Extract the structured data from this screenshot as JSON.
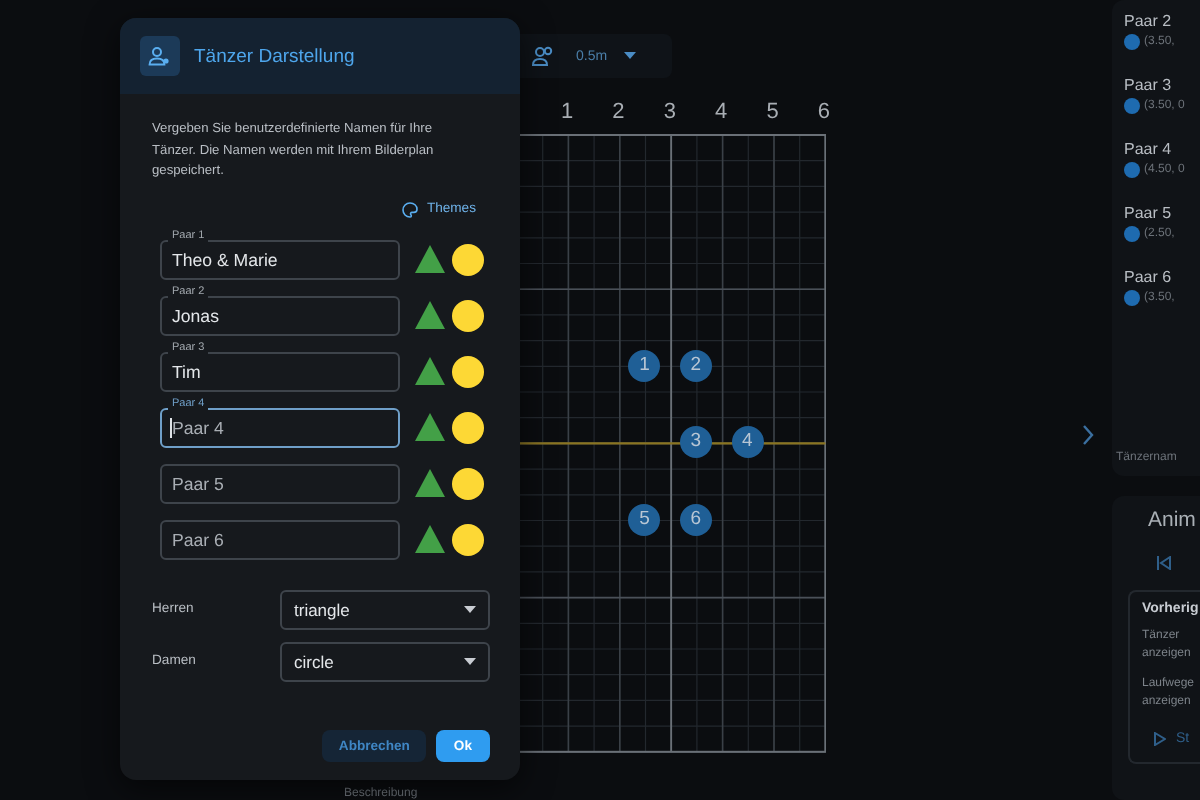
{
  "toolbar": {
    "grid_size": "0.5m"
  },
  "stage": {
    "ruler": [
      "1",
      "2",
      "3",
      "4",
      "5",
      "6"
    ],
    "dancers": [
      {
        "label": "1"
      },
      {
        "label": "2"
      },
      {
        "label": "3"
      },
      {
        "label": "4"
      },
      {
        "label": "5"
      },
      {
        "label": "6"
      }
    ]
  },
  "sidebar": {
    "dancers": [
      {
        "name": "Paar 2",
        "position": "(3.50,",
        "color": "#1e6bb0"
      },
      {
        "name": "Paar 3",
        "position": "(3.50, 0",
        "color": "#1e6bb0"
      },
      {
        "name": "Paar 4",
        "position": "(4.50, 0",
        "color": "#1e6bb0"
      },
      {
        "name": "Paar 5",
        "position": "(2.50,",
        "color": "#1e6bb0"
      },
      {
        "name": "Paar 6",
        "position": "(3.50,",
        "color": "#1e6bb0"
      }
    ],
    "footer": "Tänzernam",
    "animation": {
      "title": "Anim",
      "section_title": "Vorherig",
      "options": [
        "Tänzer anzeigen",
        "Laufwege anzeigen"
      ],
      "start_button": "St"
    }
  },
  "bottom_label": "Beschreibung",
  "dialog": {
    "title": "Tänzer Darstellung",
    "description": "Vergeben Sie benutzerdefinierte Namen für Ihre Tänzer. Die Namen werden mit Ihrem Bilderplan gespeichert.",
    "themes_link": "Themes",
    "pairs": [
      {
        "label": "Paar 1",
        "value": "Theo & Marie",
        "focused": false
      },
      {
        "label": "Paar 2",
        "value": "Jonas",
        "focused": false
      },
      {
        "label": "Paar 3",
        "value": "Tim",
        "focused": false
      },
      {
        "label": "Paar 4",
        "placeholder": "Paar 4",
        "focused": true
      },
      {
        "placeholder": "Paar 5",
        "focused": false
      },
      {
        "placeholder": "Paar 6",
        "focused": false
      }
    ],
    "markers": [
      {
        "kind": "triangle",
        "color": "#43a047"
      },
      {
        "kind": "circle",
        "color": "#fdd835"
      }
    ],
    "selects": [
      {
        "label": "Herren",
        "value": "triangle"
      },
      {
        "label": "Damen",
        "value": "circle"
      }
    ],
    "buttons": [
      {
        "label": "Abbrechen",
        "kind": "secondary"
      },
      {
        "label": "Ok",
        "kind": "primary"
      }
    ]
  }
}
